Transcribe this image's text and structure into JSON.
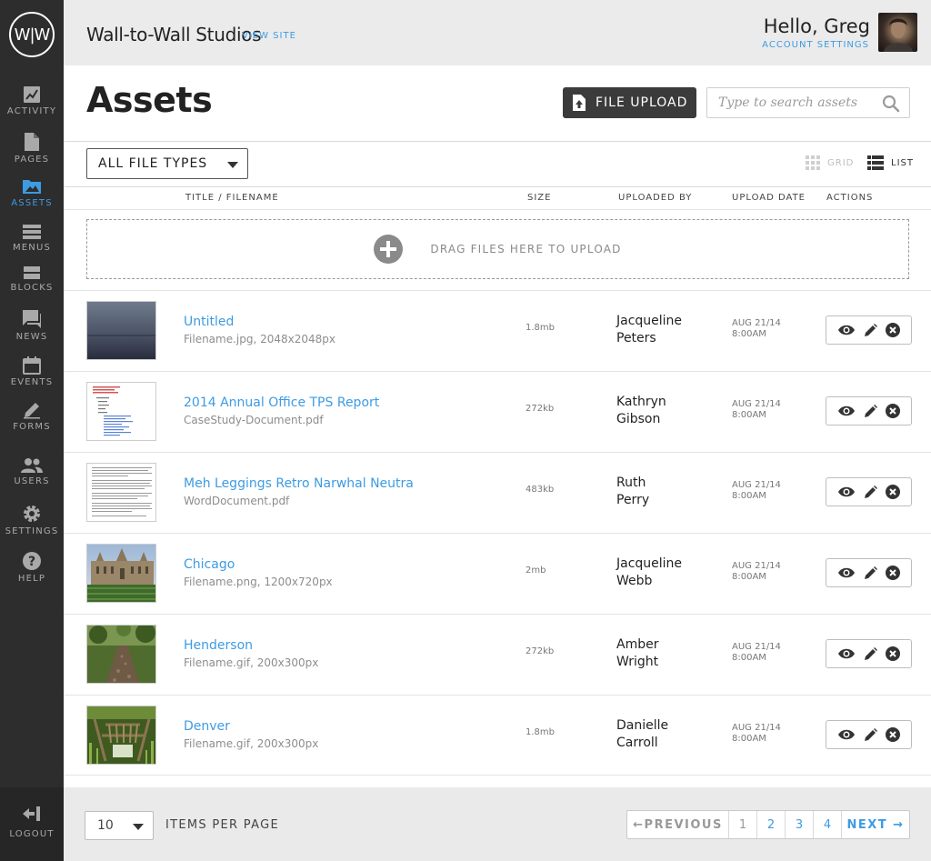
{
  "brand": {
    "logo_text": "W|W"
  },
  "sidebar": {
    "items": [
      {
        "label": "ACTIVITY",
        "icon": "activity-icon",
        "active": false
      },
      {
        "label": "PAGES",
        "icon": "page-icon",
        "active": false
      },
      {
        "label": "ASSETS",
        "icon": "image-icon",
        "active": true
      },
      {
        "label": "MENUS",
        "icon": "menu-icon",
        "active": false
      },
      {
        "label": "BLOCKS",
        "icon": "blocks-icon",
        "active": false
      },
      {
        "label": "NEWS",
        "icon": "chat-icon",
        "active": false
      },
      {
        "label": "EVENTS",
        "icon": "calendar-icon",
        "active": false
      },
      {
        "label": "FORMS",
        "icon": "pencil-icon",
        "active": false
      },
      {
        "label": "USERS",
        "icon": "users-icon",
        "active": false
      },
      {
        "label": "SETTINGS",
        "icon": "gear-icon",
        "active": false
      },
      {
        "label": "HELP",
        "icon": "help-icon",
        "active": false
      }
    ],
    "logout_label": "LOGOUT"
  },
  "header": {
    "site_name": "Wall-to-Wall Studios",
    "view_site": "VIEW SITE",
    "greeting": "Hello, Greg",
    "account_settings": "ACCOUNT SETTINGS"
  },
  "main": {
    "title": "Assets",
    "upload_label": "FILE UPLOAD",
    "search_placeholder": "Type to search assets",
    "filter_value": "ALL FILE TYPES",
    "view_grid": "GRID",
    "view_list": "LIST",
    "active_view": "LIST",
    "columns": {
      "title": "TITLE / FILENAME",
      "size": "SIZE",
      "uploaded_by": "UPLOADED BY",
      "upload_date": "UPLOAD DATE",
      "actions": "ACTIONS"
    },
    "dropzone_label": "DRAG FILES HERE TO UPLOAD",
    "rows": [
      {
        "title": "Untitled",
        "sub": "Filename.jpg, 2048x2048px",
        "size": "1.8mb",
        "user_first": "Jacqueline",
        "user_last": "Peters",
        "date": "AUG 21/14",
        "time": "8:00AM",
        "thumb": "sea"
      },
      {
        "title": "2014 Annual Office TPS Report",
        "sub": "CaseStudy-Document.pdf",
        "size": "272kb",
        "user_first": "Kathryn",
        "user_last": "Gibson",
        "date": "AUG 21/14",
        "time": "8:00AM",
        "thumb": "doc-list"
      },
      {
        "title": "Meh Leggings Retro Narwhal Neutra",
        "sub": "WordDocument.pdf",
        "size": "483kb",
        "user_first": "Ruth",
        "user_last": "Perry",
        "date": "AUG 21/14",
        "time": "8:00AM",
        "thumb": "doc-text"
      },
      {
        "title": "Chicago",
        "sub": "Filename.png, 1200x720px",
        "size": "2mb",
        "user_first": "Jacqueline",
        "user_last": "Webb",
        "date": "AUG 21/14",
        "time": "8:00AM",
        "thumb": "building"
      },
      {
        "title": "Henderson",
        "sub": "Filename.gif, 200x300px",
        "size": "272kb",
        "user_first": "Amber",
        "user_last": "Wright",
        "date": "AUG 21/14",
        "time": "8:00AM",
        "thumb": "forest"
      },
      {
        "title": "Denver",
        "sub": "Filename.gif, 200x300px",
        "size": "1.8mb",
        "user_first": "Danielle",
        "user_last": "Carroll",
        "date": "AUG 21/14",
        "time": "8:00AM",
        "thumb": "dock"
      }
    ]
  },
  "footer": {
    "per_page_value": "10",
    "per_page_label": "ITEMS PER PAGE",
    "prev_label": "←PREVIOUS",
    "pages": [
      "1",
      "2",
      "3",
      "4"
    ],
    "current_page": "1",
    "next_label": "NEXT →"
  },
  "colors": {
    "accent": "#3d9be3",
    "sidebar": "#2d2d2d",
    "dark_button": "#3b3b3b"
  }
}
